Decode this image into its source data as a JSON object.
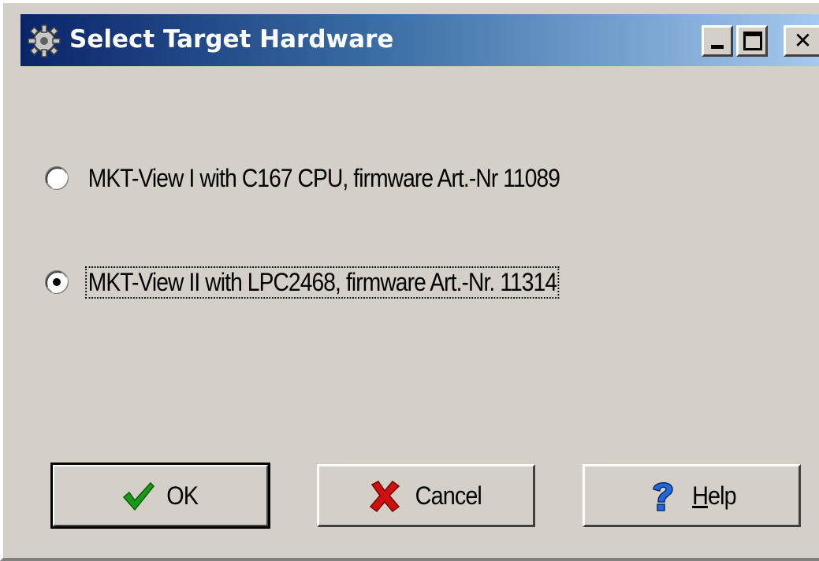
{
  "window": {
    "title": "Select Target Hardware",
    "icon": "gear-icon",
    "controls": {
      "minimize": "minimize-icon",
      "maximize": "maximize-icon",
      "close": "✕"
    }
  },
  "options": [
    {
      "label": "MKT-View I with C167 CPU,  firmware Art.-Nr 11089",
      "selected": false
    },
    {
      "label": "MKT-View II with LPC2468, firmware Art.-Nr. 11314",
      "selected": true
    }
  ],
  "buttons": {
    "ok": {
      "label": "OK",
      "icon": "checkmark-icon",
      "color": "#1a9a1a"
    },
    "cancel": {
      "label": "Cancel",
      "icon": "x-mark-icon",
      "color": "#d01010"
    },
    "help": {
      "label_prefix": "",
      "mnemonic": "H",
      "label_rest": "elp",
      "icon": "question-mark-icon",
      "color": "#1e6ad6"
    }
  }
}
